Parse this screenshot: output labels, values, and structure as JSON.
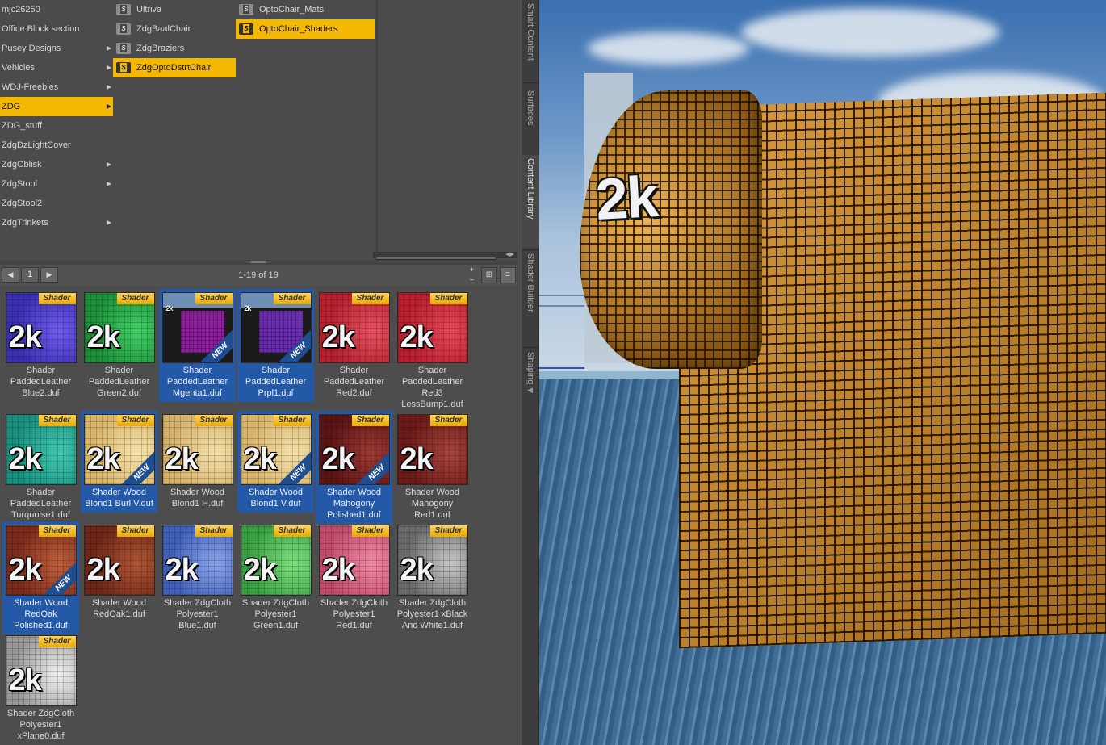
{
  "browser": {
    "col1": [
      {
        "label": "mjc26250",
        "arrow": false,
        "selected": false
      },
      {
        "label": "Office Block section",
        "arrow": false,
        "selected": false
      },
      {
        "label": "Pusey Designs",
        "arrow": true,
        "selected": false
      },
      {
        "label": "Vehicles",
        "arrow": true,
        "selected": false
      },
      {
        "label": "WDJ-Freebies",
        "arrow": true,
        "selected": false
      },
      {
        "label": "ZDG",
        "arrow": true,
        "selected": true
      },
      {
        "label": "ZDG_stuff",
        "arrow": false,
        "selected": false
      },
      {
        "label": "ZdgDzLightCover",
        "arrow": false,
        "selected": false
      },
      {
        "label": "ZdgOblisk",
        "arrow": true,
        "selected": false
      },
      {
        "label": "ZdgStool",
        "arrow": true,
        "selected": false
      },
      {
        "label": "ZdgStool2",
        "arrow": false,
        "selected": false
      },
      {
        "label": "ZdgTrinkets",
        "arrow": true,
        "selected": false
      }
    ],
    "col2": [
      {
        "label": "Ultriva",
        "selected": false
      },
      {
        "label": "ZdgBaalChair",
        "selected": false
      },
      {
        "label": "ZdgBraziers",
        "selected": false
      },
      {
        "label": "ZdgOptoDstrtChair",
        "selected": true
      }
    ],
    "col3": [
      {
        "label": "OptoChair_Mats",
        "selected": false
      },
      {
        "label": "OptoChair_Shaders",
        "selected": true
      }
    ]
  },
  "toolbar": {
    "page": "1",
    "count": "1-19 of 19",
    "prev_icon": "arrow-left-icon",
    "next_icon": "arrow-right-icon"
  },
  "thumb_badge": "Shader",
  "thumb_mark": "2k",
  "new_badge": "NEW",
  "tiles": [
    {
      "name": "Shader PaddedLeather Blue2.duf",
      "color": "#3a2fb0",
      "hi": "#6f5cf0",
      "selected": false,
      "isnew": false,
      "small": false
    },
    {
      "name": "Shader PaddedLeather Green2.duf",
      "color": "#1f8f3a",
      "hi": "#3fd066",
      "selected": false,
      "isnew": false,
      "small": false
    },
    {
      "name": "Shader PaddedLeather Mgenta1.duf",
      "color": "#8d1f9c",
      "hi": "#c64ad6",
      "selected": true,
      "isnew": true,
      "small": true
    },
    {
      "name": "Shader PaddedLeather Prpl1.duf",
      "color": "#6a2cb0",
      "hi": "#9a5ae0",
      "selected": true,
      "isnew": true,
      "small": true
    },
    {
      "name": "Shader PaddedLeather Red2.duf",
      "color": "#b3202e",
      "hi": "#e85060",
      "selected": false,
      "isnew": false,
      "small": false
    },
    {
      "name": "Shader PaddedLeather Red3 LessBump1.duf",
      "color": "#b81e2e",
      "hi": "#e84858",
      "selected": false,
      "isnew": false,
      "small": false
    },
    {
      "name": "Shader PaddedLeather Turquoise1.duf",
      "color": "#1a8f7e",
      "hi": "#3fc7b0",
      "selected": false,
      "isnew": false,
      "small": false
    },
    {
      "name": "Shader Wood Blond1 Burl V.duf",
      "color": "#d8b46a",
      "hi": "#f5e2a8",
      "selected": true,
      "isnew": true,
      "small": false
    },
    {
      "name": "Shader Wood Blond1 H.duf",
      "color": "#d5b26c",
      "hi": "#f3dfa6",
      "selected": false,
      "isnew": false,
      "small": false
    },
    {
      "name": "Shader Wood Blond1 V.duf",
      "color": "#d6b36a",
      "hi": "#f4e0a8",
      "selected": true,
      "isnew": true,
      "small": false
    },
    {
      "name": "Shader Wood Mahogony Polished1.duf",
      "color": "#5a1414",
      "hi": "#a03a36",
      "selected": true,
      "isnew": true,
      "small": false
    },
    {
      "name": "Shader Wood Mahogony Red1.duf",
      "color": "#6a1a18",
      "hi": "#a8443c",
      "selected": false,
      "isnew": false,
      "small": false
    },
    {
      "name": "Shader Wood RedOak Polished1.duf",
      "color": "#7a2a1a",
      "hi": "#c0603a",
      "selected": true,
      "isnew": true,
      "small": false
    },
    {
      "name": "Shader Wood RedOak1.duf",
      "color": "#6e2616",
      "hi": "#b05634",
      "selected": false,
      "isnew": false,
      "small": false
    },
    {
      "name": "Shader ZdgCloth Polyester1 Blue1.duf",
      "color": "#3f5fb8",
      "hi": "#8aa6ec",
      "selected": false,
      "isnew": false,
      "small": false
    },
    {
      "name": "Shader ZdgCloth Polyester1 Green1.duf",
      "color": "#38a040",
      "hi": "#7ee07e",
      "selected": false,
      "isnew": false,
      "small": false
    },
    {
      "name": "Shader ZdgCloth Polyester1 Red1.duf",
      "color": "#c04a6a",
      "hi": "#f08aa4",
      "selected": false,
      "isnew": false,
      "small": false
    },
    {
      "name": "Shader ZdgCloth Polyester1 xBlack And White1.duf",
      "color": "#6a6a6a",
      "hi": "#c8c8c8",
      "selected": false,
      "isnew": false,
      "small": false
    },
    {
      "name": "Shader ZdgCloth Polyester1 xPlane0.duf",
      "color": "#9a9a9a",
      "hi": "#f2f2f2",
      "selected": false,
      "isnew": false,
      "small": false
    }
  ],
  "side_tabs": [
    {
      "label": "Smart Content",
      "active": false
    },
    {
      "label": "Surfaces",
      "active": false
    },
    {
      "label": "Content Library",
      "active": true
    },
    {
      "label": "Shader Builder",
      "active": false
    },
    {
      "label": "Shaping",
      "active": false
    }
  ],
  "viewport": {
    "mark": "2k"
  }
}
